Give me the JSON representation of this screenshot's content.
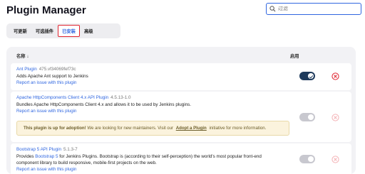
{
  "page": {
    "title": "Plugin Manager"
  },
  "search": {
    "placeholder": "过滤",
    "value": ""
  },
  "tabs": [
    {
      "label": "可更新"
    },
    {
      "label": "可选插件"
    },
    {
      "label": "已安装"
    },
    {
      "label": "高级"
    }
  ],
  "table": {
    "name_header": "名称 ↓",
    "enabled_header": "启用"
  },
  "plugins": [
    {
      "name": "Ant Plugin",
      "version": "475.vf34069fef73c",
      "description": "Adds Apache Ant support to Jenkins",
      "report": "Report an issue with this plugin",
      "enabled": true
    },
    {
      "name": "Apache HttpComponents Client 4.x API Plugin",
      "version": "4.5.13-1.0",
      "description": "Bundles Apache HttpComponents Client 4.x and allows it to be used by Jenkins plugins.",
      "report": "Report an issue with this plugin",
      "adoption": {
        "bold": "This plugin is up for adoption!",
        "text_before": " We are looking for new maintainers. Visit our ",
        "link": "Adopt a Plugin",
        "text_after": " initiative for more information."
      },
      "enabled": true
    },
    {
      "name": "Bootstrap 5 API Plugin",
      "version": "5.1.3-7",
      "description_prefix": "Provides ",
      "description_link": "Bootstrap 5",
      "description_suffix": " for Jenkins Plugins. Bootstrap is (according to their self-perception) the world's most popular front-end",
      "description_line2": "component library to build responsive, mobile-first projects on the web.",
      "report": "Report an issue with this plugin",
      "enabled": true
    }
  ],
  "colors": {
    "accent": "#2f66e0",
    "toggle_on": "#1e3a5c",
    "uninstall": "#e0242f"
  },
  "icons": {
    "search": "search-icon",
    "uninstall": "close-circle-icon"
  }
}
